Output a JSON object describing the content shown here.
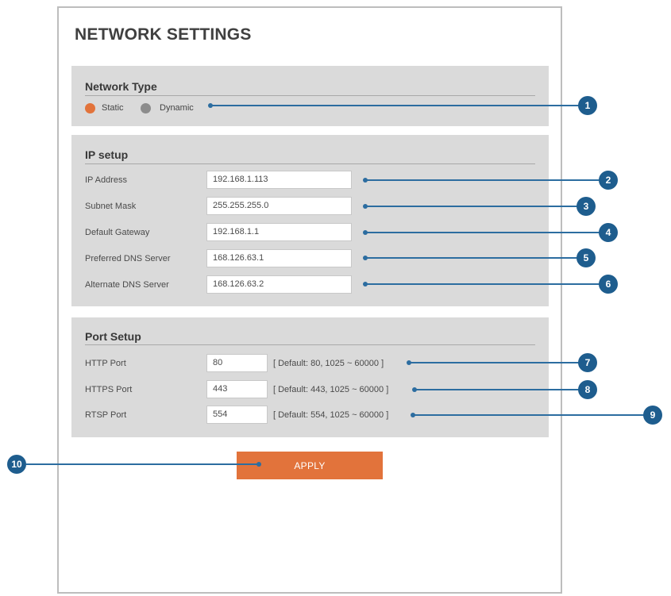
{
  "page": {
    "title": "NETWORK SETTINGS"
  },
  "network_type": {
    "title": "Network Type",
    "options": [
      {
        "label": "Static",
        "selected": true,
        "color": "#e2733b"
      },
      {
        "label": "Dynamic",
        "selected": false,
        "color": "#8c8c8c"
      }
    ]
  },
  "ip_setup": {
    "title": "IP setup",
    "fields": [
      {
        "label": "IP Address",
        "value": "192.168.1.113"
      },
      {
        "label": "Subnet Mask",
        "value": "255.255.255.0"
      },
      {
        "label": "Default Gateway",
        "value": "192.168.1.1"
      },
      {
        "label": "Preferred DNS Server",
        "value": "168.126.63.1"
      },
      {
        "label": "Alternate DNS Server",
        "value": "168.126.63.2"
      }
    ]
  },
  "port_setup": {
    "title": "Port Setup",
    "fields": [
      {
        "label": "HTTP Port",
        "value": "80",
        "hint": "[ Default: 80, 1025 ~ 60000 ]"
      },
      {
        "label": "HTTPS Port",
        "value": "443",
        "hint": "[ Default: 443, 1025 ~ 60000 ]"
      },
      {
        "label": "RTSP Port",
        "value": "554",
        "hint": "[ Default: 554, 1025 ~ 60000 ]"
      }
    ]
  },
  "apply_label": "APPLY",
  "callouts": [
    "1",
    "2",
    "3",
    "4",
    "5",
    "6",
    "7",
    "8",
    "9",
    "10"
  ],
  "colors": {
    "accent": "#e2733b",
    "callout": "#1e5d8e",
    "panel": "#dadada"
  }
}
